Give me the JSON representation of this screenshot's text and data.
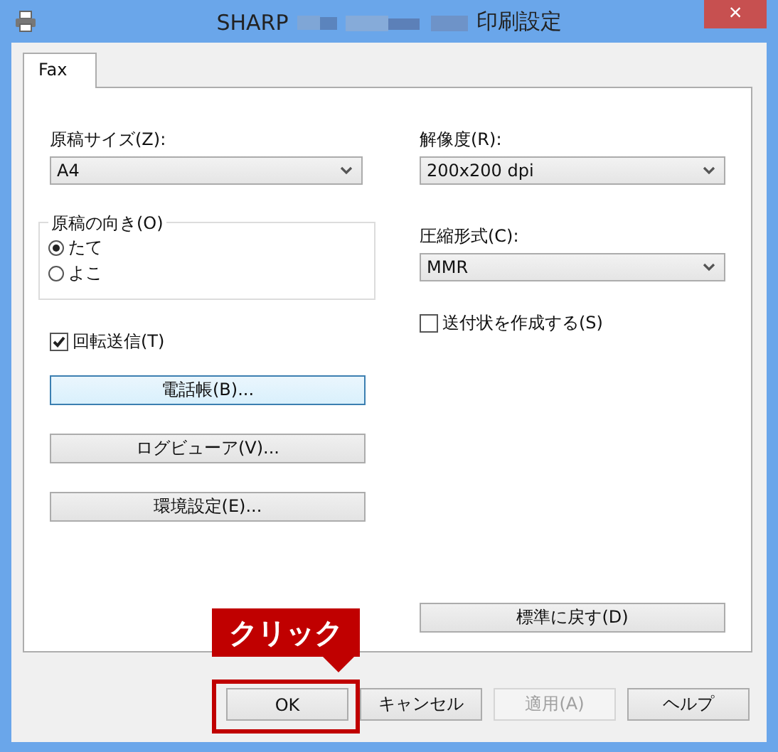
{
  "window": {
    "title_prefix": "SHARP",
    "title_suffix": "印刷設定",
    "close": "×"
  },
  "tabs": [
    {
      "label": "Fax",
      "selected": true
    }
  ],
  "paper_size": {
    "label": "原稿サイズ(Z):",
    "value": "A4"
  },
  "orientation": {
    "label": "原稿の向き(O)",
    "options": [
      {
        "label": "たて",
        "selected": true
      },
      {
        "label": "よこ",
        "selected": false
      }
    ]
  },
  "rotate": {
    "label": "回転送信(T)",
    "checked": true
  },
  "left_buttons": [
    {
      "label": "電話帳(B)...",
      "focused": true
    },
    {
      "label": "ログビューア(V)...",
      "focused": false
    },
    {
      "label": "環境設定(E)...",
      "focused": false
    }
  ],
  "resolution": {
    "label": "解像度(R):",
    "value": "200x200 dpi"
  },
  "compression": {
    "label": "圧縮形式(C):",
    "value": "MMR"
  },
  "cover_sheet": {
    "label": "送付状を作成する(S)",
    "checked": false
  },
  "reset_button": "標準に戻す(D)",
  "buttons": [
    {
      "label": "OK",
      "disabled": false,
      "highlighted": true
    },
    {
      "label": "キャンセル",
      "disabled": false,
      "highlighted": false
    },
    {
      "label": "適用(A)",
      "disabled": true,
      "highlighted": false
    },
    {
      "label": "ヘルプ",
      "disabled": false,
      "highlighted": false
    }
  ],
  "callout": {
    "text": "クリック"
  }
}
